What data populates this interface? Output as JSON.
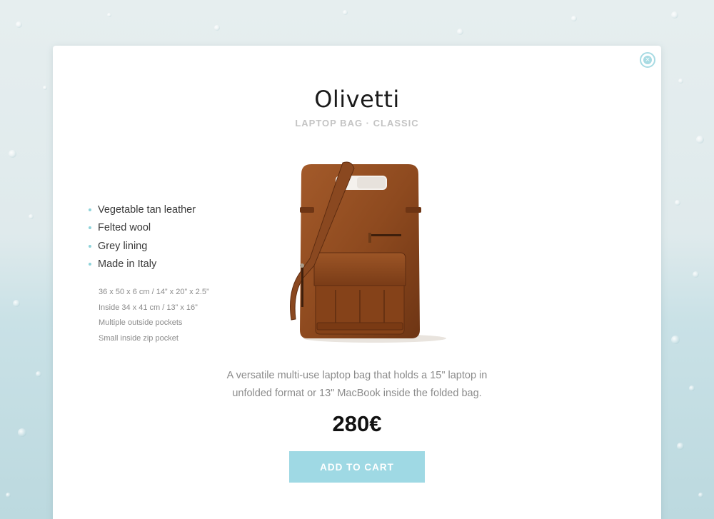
{
  "product": {
    "name": "Olivetti",
    "subtitle": "LAPTOP BAG · CLASSIC",
    "features": [
      "Vegetable tan leather",
      "Felted wool",
      "Grey lining",
      "Made in Italy"
    ],
    "specs": [
      "36 x 50 x 6 cm / 14” x 20” x 2.5”",
      "Inside 34 x 41 cm / 13” x 16”",
      "Multiple outside pockets",
      "Small inside zip pocket"
    ],
    "description_lines": [
      "A versatile multi-use laptop bag that holds a 15\" laptop in",
      "unfolded format or 13\" MacBook inside the folded bag."
    ],
    "price": "280€",
    "add_to_cart_label": "ADD TO CART"
  },
  "close_icon": "×",
  "colors": {
    "accent": "#9fd9e4",
    "bullet": "#8fd3da",
    "leather": "#8e4a1f",
    "text_muted": "#8b8b8b"
  },
  "icons": [
    "close-icon",
    "bag-image",
    "bullet-dot"
  ]
}
